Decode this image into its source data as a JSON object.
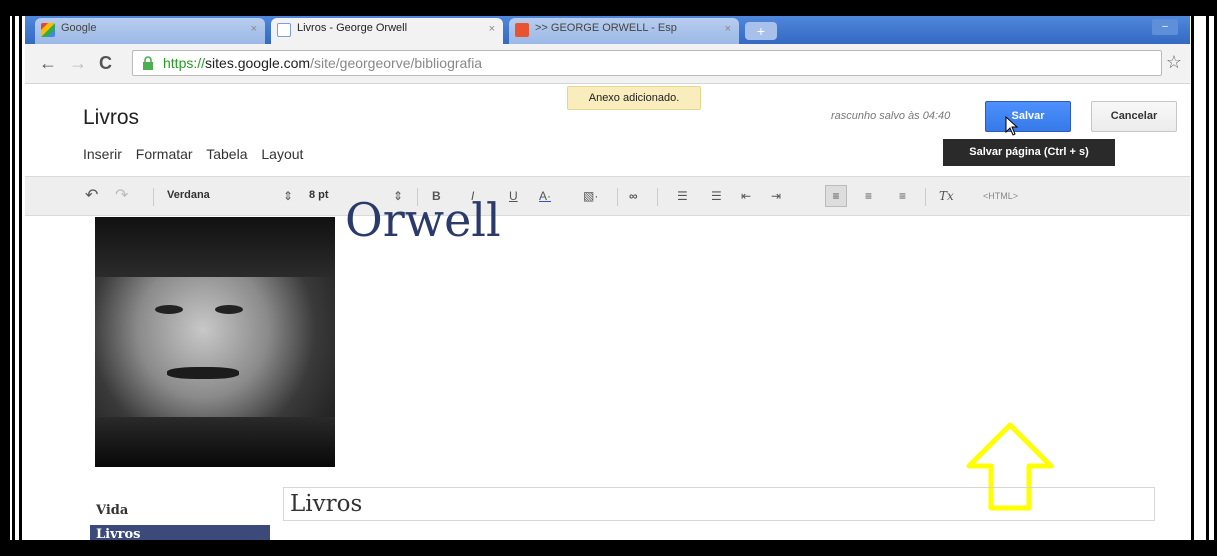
{
  "browser": {
    "tabs": [
      {
        "label": "Google"
      },
      {
        "label": "Livros - George Orwell"
      },
      {
        "label": ">> GEORGE ORWELL - Esp"
      }
    ],
    "url_scheme": "https://",
    "url_host": "sites.google.com",
    "url_path": "/site/georgeorve/bibliografia"
  },
  "page": {
    "title": "Livros",
    "menu": [
      "Inserir",
      "Formatar",
      "Tabela",
      "Layout"
    ],
    "toast": "Anexo adicionado.",
    "draft_status": "rascunho salvo às 04:40",
    "save_label": "Salvar",
    "cancel_label": "Cancelar",
    "tooltip": "Salvar página (Ctrl + s)"
  },
  "editor": {
    "font": "Verdana",
    "size": "8 pt",
    "html_label": "<HTML>"
  },
  "content": {
    "big_title": "Orwell",
    "nav": [
      "Vida",
      "Livros"
    ],
    "heading": "Livros"
  },
  "colors": {
    "save_blue": "#357ae8",
    "arrow_yellow": "#ffff00",
    "nav_active": "#3b4a7a"
  }
}
